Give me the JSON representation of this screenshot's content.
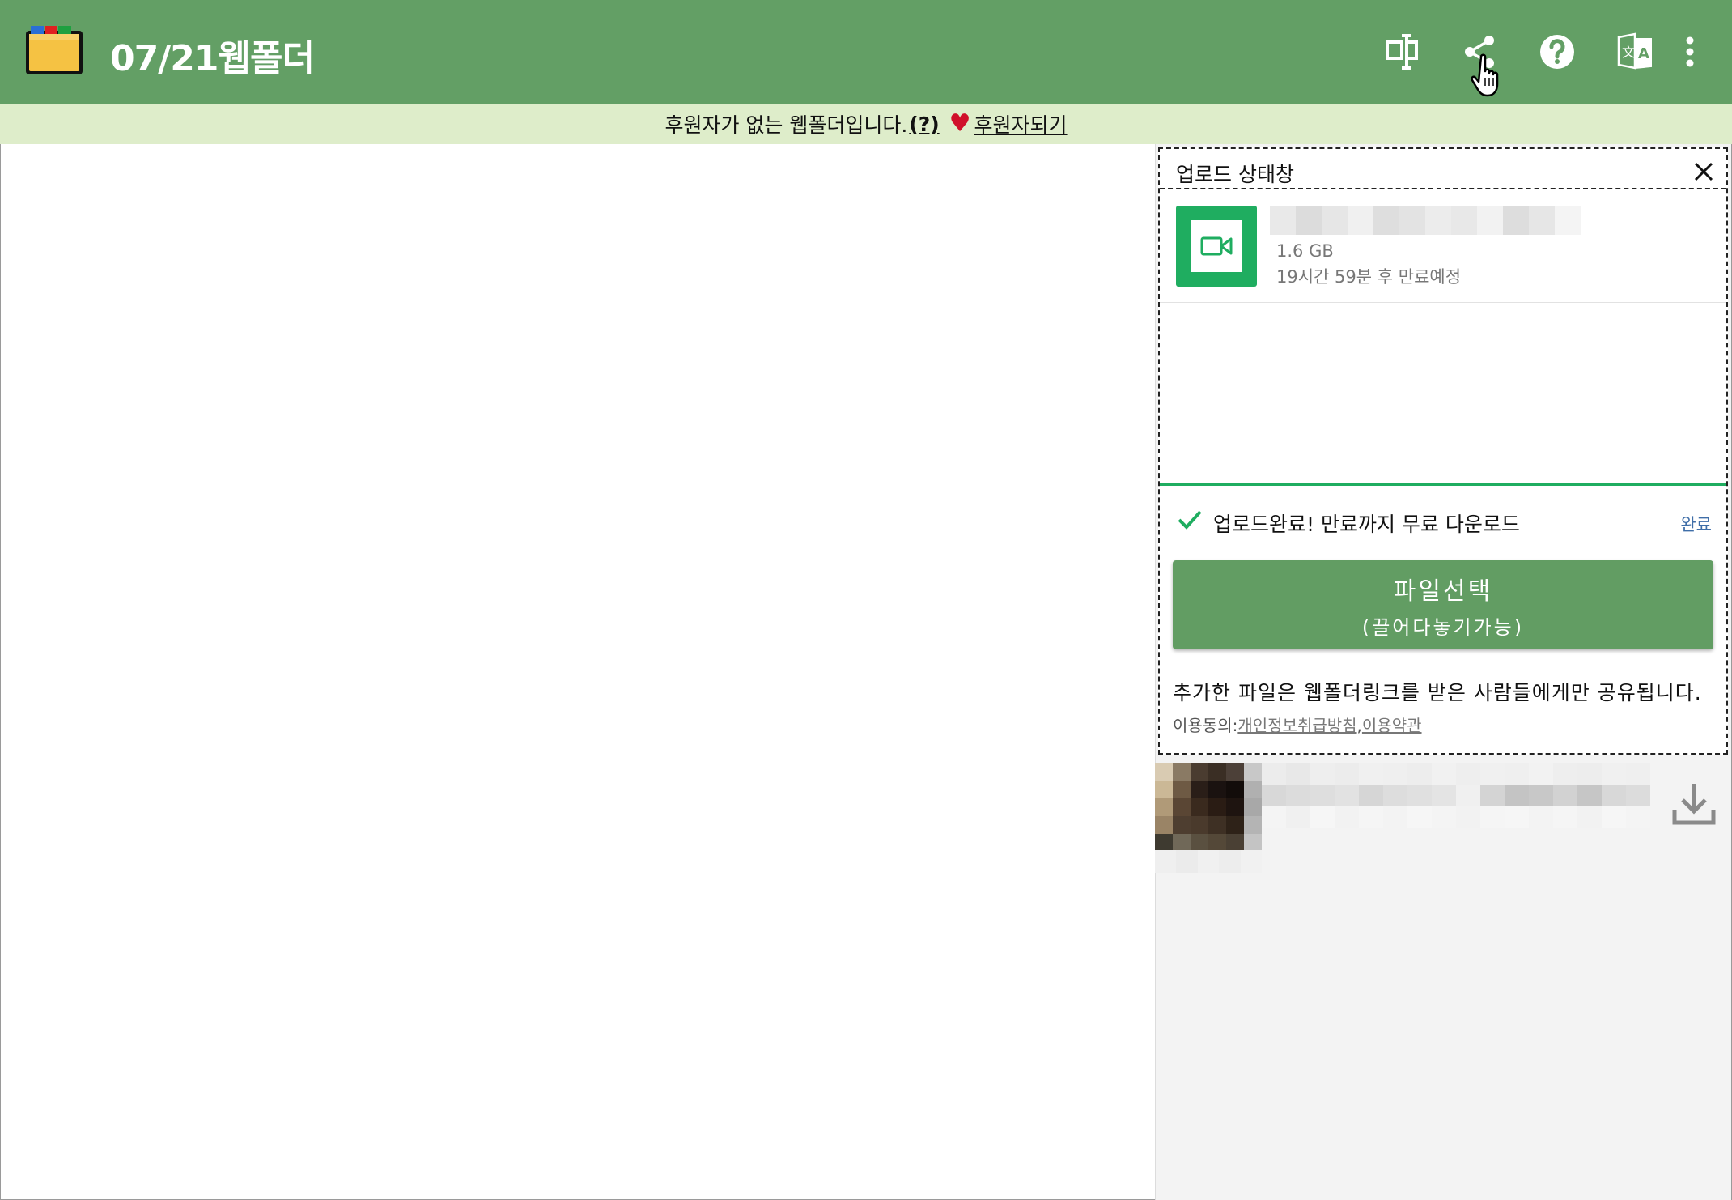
{
  "header": {
    "title": "07/21웹폴더",
    "buttons": [
      {
        "name": "desktop-sync-icon"
      },
      {
        "name": "share-icon"
      },
      {
        "name": "help-icon"
      },
      {
        "name": "translate-icon"
      },
      {
        "name": "more-menu-icon"
      }
    ],
    "color": "#639f65"
  },
  "notice": {
    "text": "후원자가 없는 웹폴더입니다.",
    "help": "(?)",
    "sponsor_link": "후원자되기"
  },
  "upload_panel": {
    "title": "업로드 상태창",
    "file": {
      "size": "1.6 GB",
      "expire": "19시간 59분 후 만료예정",
      "icon": "video-icon"
    },
    "status_text": "업로드완료! 만료까지 무료 다운로드",
    "status_link": "완료",
    "select_button": {
      "line1": "파일선택",
      "line2": "(끌어다놓기가능)"
    },
    "share_note": "추가한 파일은 웹폴더링크를 받은 사람들에게만 공유됩니다.",
    "consent_label": "이용동의:",
    "privacy_link": "개인정보취급방침",
    "comma": ",",
    "terms_link": "이용약관"
  },
  "colors": {
    "accent_green": "#639f65",
    "success_green": "#1fad60",
    "notice_bg": "#deedca"
  }
}
